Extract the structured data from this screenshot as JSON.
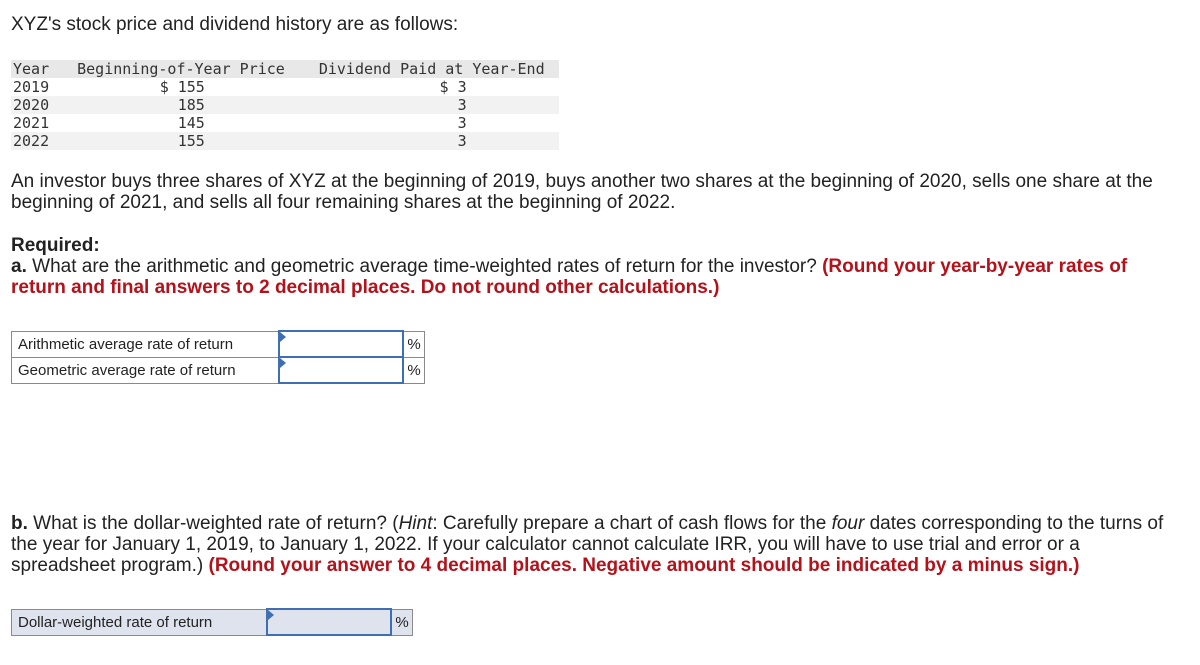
{
  "intro": "XYZ's stock price and dividend history are as follows:",
  "table": {
    "headers": [
      "Year",
      "Beginning-of-Year Price",
      "Dividend Paid at Year-End"
    ],
    "rows": [
      {
        "year": "2019",
        "price": "$ 155",
        "dividend": "$ 3"
      },
      {
        "year": "2020",
        "price": "185",
        "dividend": "3"
      },
      {
        "year": "2021",
        "price": "145",
        "dividend": "3"
      },
      {
        "year": "2022",
        "price": "155",
        "dividend": "3"
      }
    ]
  },
  "scenario": "An investor buys three shares of XYZ at the beginning of 2019, buys another two shares at the beginning of 2020, sells one share at the beginning of 2021, and sells all four remaining shares at the beginning of 2022.",
  "required_label": "Required:",
  "part_a": {
    "prefix": "a.",
    "question": " What are the arithmetic and geometric average time-weighted rates of return for the investor? ",
    "instruction": "(Round your year-by-year rates of return and final answers to 2 decimal places. Do not round other calculations.)",
    "rows": [
      {
        "label": "Arithmetic average rate of return",
        "value": "",
        "unit": "%"
      },
      {
        "label": "Geometric average rate of return",
        "value": "",
        "unit": "%"
      }
    ]
  },
  "part_b": {
    "prefix": "b.",
    "q1": " What is the dollar-weighted rate of return? (",
    "hint_label": "Hint",
    "q2": ": Carefully prepare a chart of cash flows for the ",
    "emph": "four",
    "q3": " dates corresponding to the turns of the year for January 1, 2019, to January 1, 2022. If your calculator cannot calculate IRR, you will have to use trial and error or a spreadsheet program.) ",
    "instruction": "(Round your answer to 4 decimal places. Negative amount should be indicated by a minus sign.)",
    "row": {
      "label": "Dollar-weighted rate of return",
      "value": "",
      "unit": "%"
    }
  }
}
